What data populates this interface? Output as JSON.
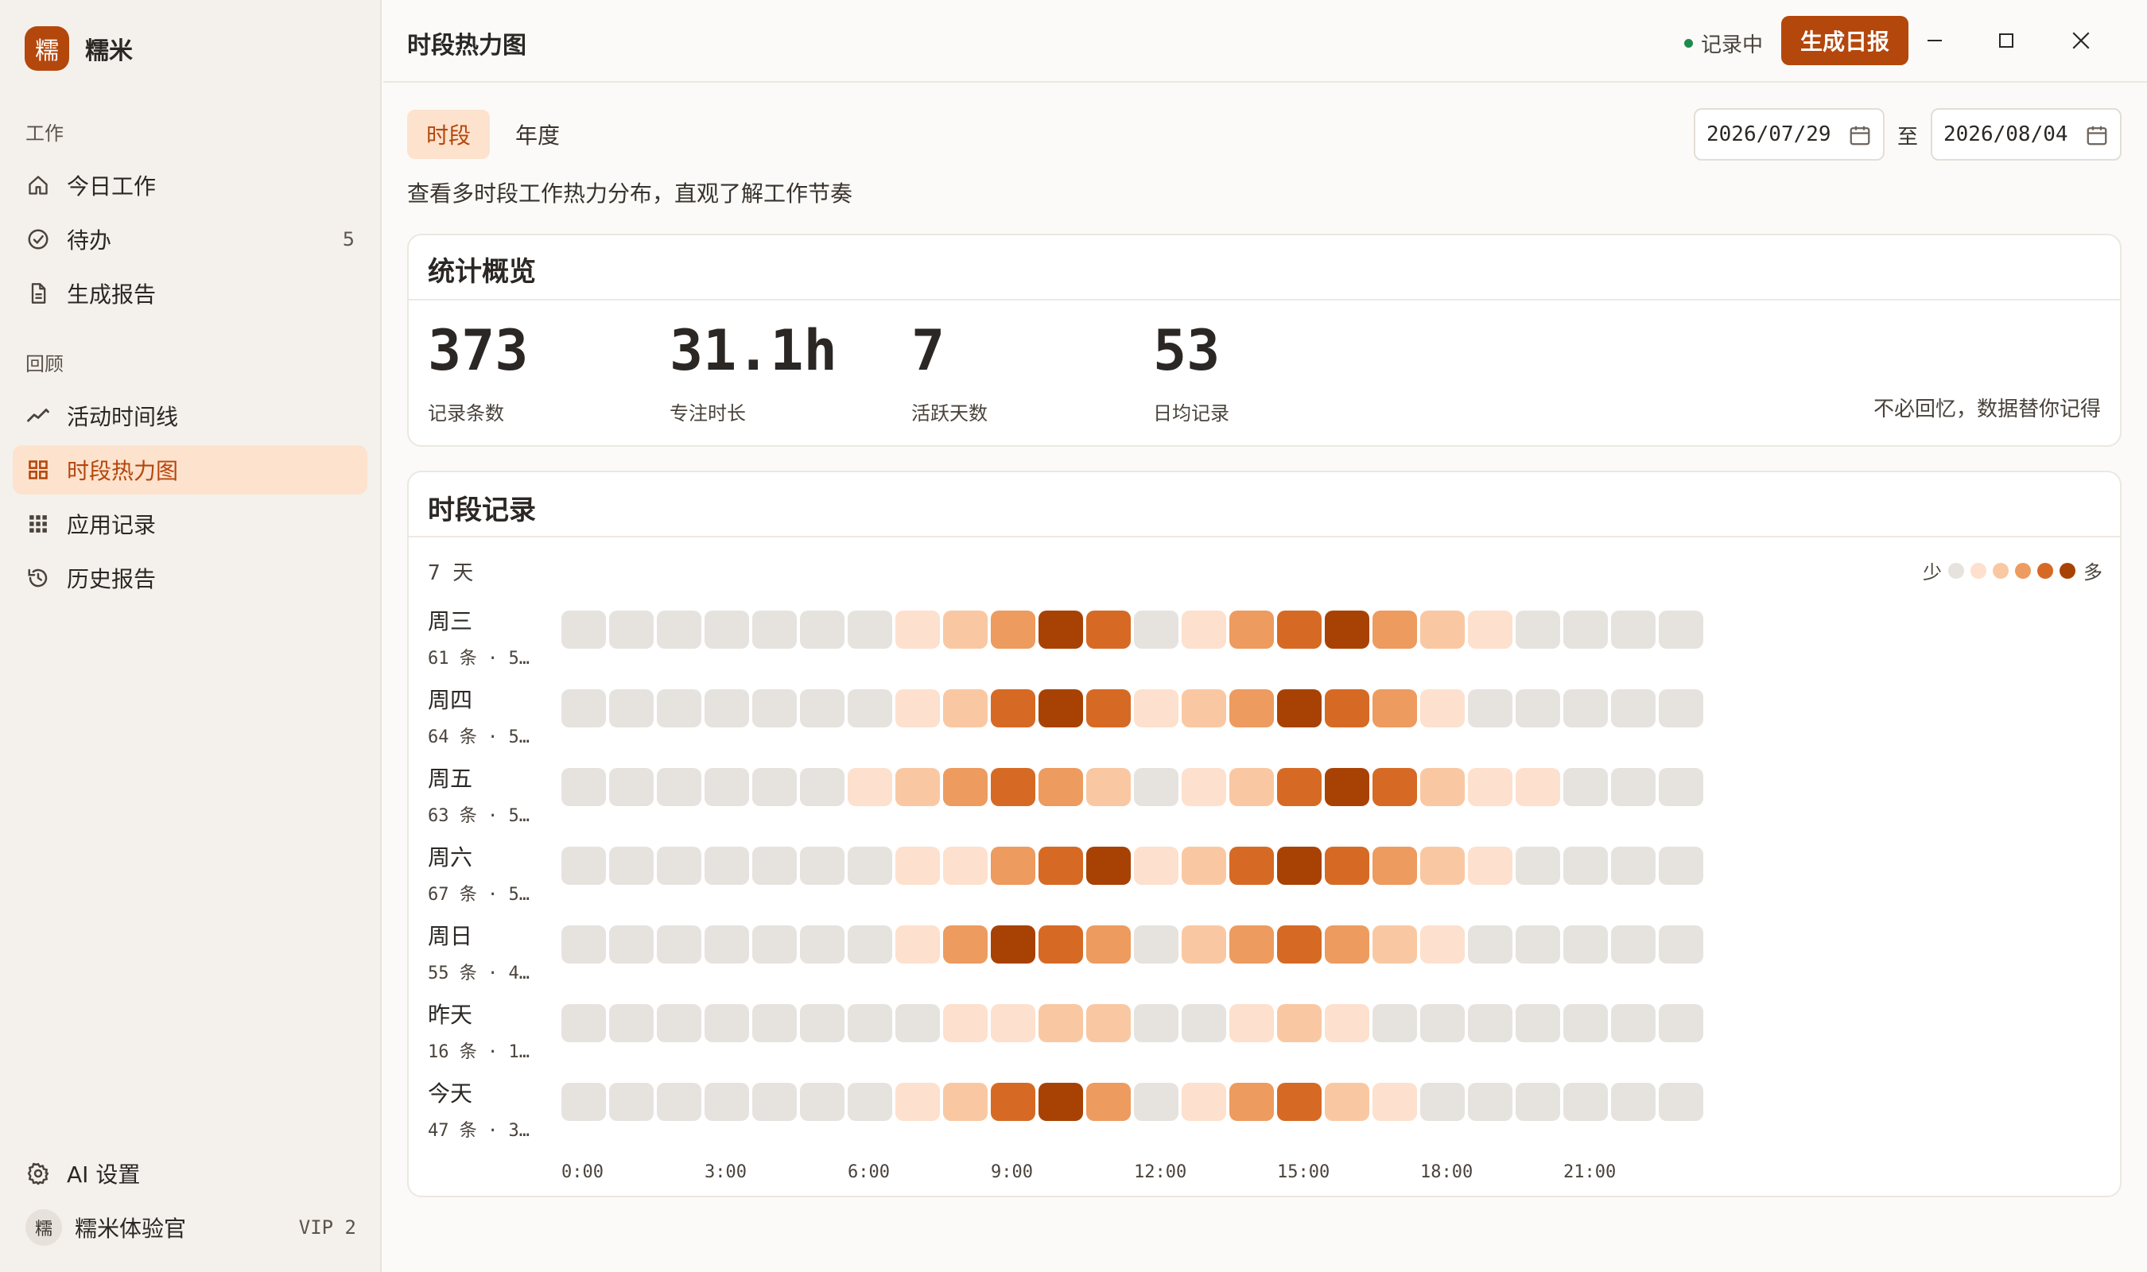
{
  "app": {
    "logo_char": "糯",
    "name": "糯米"
  },
  "sidebar": {
    "section_work": "工作",
    "section_review": "回顾",
    "items": [
      {
        "label": "今日工作",
        "icon": "home-icon"
      },
      {
        "label": "待办",
        "icon": "check-circle-icon",
        "count": "5"
      },
      {
        "label": "生成报告",
        "icon": "document-icon"
      },
      {
        "label": "活动时间线",
        "icon": "trend-icon"
      },
      {
        "label": "时段热力图",
        "icon": "grid-icon",
        "active": true
      },
      {
        "label": "应用记录",
        "icon": "apps-icon"
      },
      {
        "label": "历史报告",
        "icon": "history-icon"
      }
    ],
    "settings_label": "AI 设置",
    "user": {
      "avatar_char": "糯",
      "name": "糯米体验官",
      "tier": "VIP 2"
    }
  },
  "header": {
    "title": "时段热力图",
    "status": "记录中",
    "generate_button": "生成日报"
  },
  "tabs": [
    {
      "label": "时段",
      "active": true
    },
    {
      "label": "年度",
      "active": false
    }
  ],
  "date_range": {
    "start": "2026/07/29",
    "separator": "至",
    "end": "2026/08/04"
  },
  "subtitle": "查看多时段工作热力分布，直观了解工作节奏",
  "stats": {
    "title": "统计概览",
    "items": [
      {
        "value": "373",
        "label": "记录条数"
      },
      {
        "value": "31.1h",
        "label": "专注时长"
      },
      {
        "value": "7",
        "label": "活跃天数"
      },
      {
        "value": "53",
        "label": "日均记录"
      }
    ],
    "slogan": "不必回忆，数据替你记得"
  },
  "heatmap": {
    "title": "时段记录",
    "days_count": "7 天",
    "legend_less": "少",
    "legend_more": "多",
    "levels": [
      "#e6e3df",
      "#fde0cd",
      "#f9c8a2",
      "#ed9b5f",
      "#d66a24",
      "#a84204"
    ],
    "rows": [
      {
        "day": "周三",
        "meta": "61 条 · 5…",
        "levels": [
          0,
          0,
          0,
          0,
          0,
          0,
          0,
          1,
          2,
          3,
          5,
          4,
          0,
          1,
          3,
          4,
          5,
          3,
          2,
          1,
          0,
          0,
          0,
          0
        ]
      },
      {
        "day": "周四",
        "meta": "64 条 · 5…",
        "levels": [
          0,
          0,
          0,
          0,
          0,
          0,
          0,
          1,
          2,
          4,
          5,
          4,
          1,
          2,
          3,
          5,
          4,
          3,
          1,
          0,
          0,
          0,
          0,
          0
        ]
      },
      {
        "day": "周五",
        "meta": "63 条 · 5…",
        "levels": [
          0,
          0,
          0,
          0,
          0,
          0,
          1,
          2,
          3,
          4,
          3,
          2,
          0,
          1,
          2,
          4,
          5,
          4,
          2,
          1,
          1,
          0,
          0,
          0
        ]
      },
      {
        "day": "周六",
        "meta": "67 条 · 5…",
        "levels": [
          0,
          0,
          0,
          0,
          0,
          0,
          0,
          1,
          1,
          3,
          4,
          5,
          1,
          2,
          4,
          5,
          4,
          3,
          2,
          1,
          0,
          0,
          0,
          0
        ]
      },
      {
        "day": "周日",
        "meta": "55 条 · 4…",
        "levels": [
          0,
          0,
          0,
          0,
          0,
          0,
          0,
          1,
          3,
          5,
          4,
          3,
          0,
          2,
          3,
          4,
          3,
          2,
          1,
          0,
          0,
          0,
          0,
          0
        ]
      },
      {
        "day": "昨天",
        "meta": "16 条 · 1…",
        "levels": [
          0,
          0,
          0,
          0,
          0,
          0,
          0,
          0,
          1,
          1,
          2,
          2,
          0,
          0,
          1,
          2,
          1,
          0,
          0,
          0,
          0,
          0,
          0,
          0
        ]
      },
      {
        "day": "今天",
        "meta": "47 条 · 3…",
        "levels": [
          0,
          0,
          0,
          0,
          0,
          0,
          0,
          1,
          2,
          4,
          5,
          3,
          0,
          1,
          3,
          4,
          2,
          1,
          0,
          0,
          0,
          0,
          0,
          0
        ]
      }
    ],
    "axis": [
      "0:00",
      "3:00",
      "6:00",
      "9:00",
      "12:00",
      "15:00",
      "18:00",
      "21:00"
    ]
  },
  "colors": {
    "accent": "#b4470c",
    "accent_soft": "#fde2cd",
    "status_green": "#1f8a4c"
  }
}
